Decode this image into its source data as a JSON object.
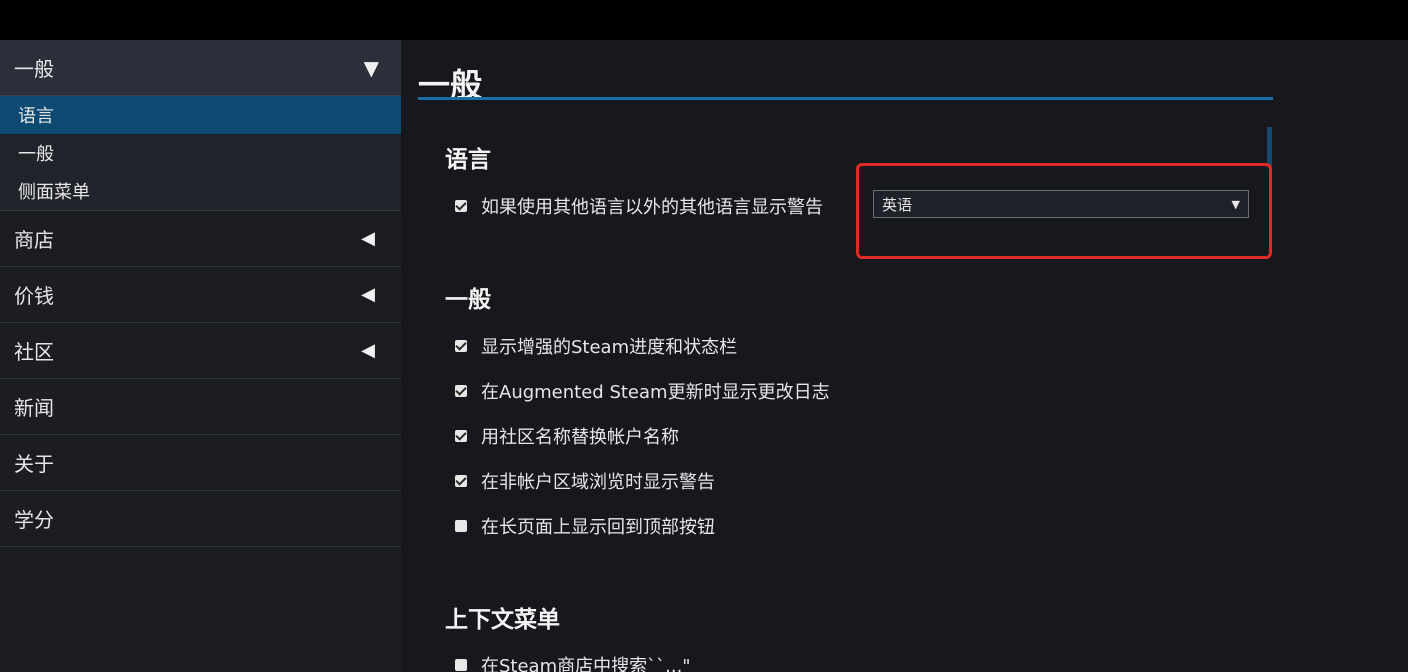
{
  "sidebar": {
    "header": {
      "label": "一般",
      "arrow": "▼"
    },
    "sub_items": [
      {
        "label": "语言",
        "active": true
      },
      {
        "label": "一般",
        "active": false
      },
      {
        "label": "侧面菜单",
        "active": false
      }
    ],
    "items": [
      {
        "label": "商店",
        "arrow": "◀"
      },
      {
        "label": "价钱",
        "arrow": "◀"
      },
      {
        "label": "社区",
        "arrow": "◀"
      },
      {
        "label": "新闻",
        "arrow": ""
      },
      {
        "label": "关于",
        "arrow": ""
      },
      {
        "label": "学分",
        "arrow": ""
      }
    ]
  },
  "main": {
    "page_title": "一般",
    "sections": {
      "language": {
        "title": "语言",
        "option": {
          "label": "如果使用其他语言以外的其他语言显示警告",
          "checked": true
        },
        "select": {
          "value": "英语",
          "caret": "▼"
        }
      },
      "general": {
        "title": "一般",
        "options": [
          {
            "label": "显示增强的Steam进度和状态栏",
            "checked": true
          },
          {
            "label": "在Augmented Steam更新时显示更改日志",
            "checked": true
          },
          {
            "label": "用社区名称替换帐户名称",
            "checked": true
          },
          {
            "label": "在非帐户区域浏览时显示警告",
            "checked": true
          },
          {
            "label": "在长页面上显示回到顶部按钮",
            "checked": false
          }
        ]
      },
      "context_menu": {
        "title": "上下文菜单",
        "options": [
          {
            "label": "在Steam商店中搜索``...\"",
            "checked": false
          }
        ]
      }
    }
  },
  "colors": {
    "accent": "#1a6fa8",
    "active_item": "#0c4a72",
    "highlight": "#e02a25"
  }
}
